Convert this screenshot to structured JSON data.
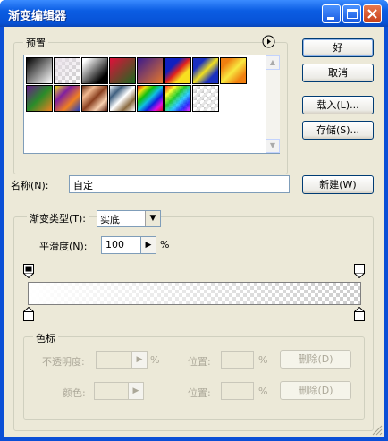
{
  "window": {
    "title": "渐变编辑器"
  },
  "presets": {
    "label": "预置",
    "menu_icon": "circle-arrow-right-icon",
    "swatches": [
      "black-white",
      "transparent-checker",
      "black-white-reverse",
      "red-green",
      "violet-orange",
      "blue-red-yellow",
      "blue-yellow-blue",
      "orange-yellow-orange",
      "violet-green-orange",
      "yellow-violet-orange-blue",
      "copper",
      "chrome",
      "spectrum",
      "transparent-rainbow",
      "transparent-stripes"
    ]
  },
  "buttons": {
    "ok": "好",
    "cancel": "取消",
    "load": "载入(L)...",
    "save": "存储(S)...",
    "new": "新建(W)"
  },
  "name": {
    "label": "名称(N):",
    "value": "自定"
  },
  "gradient": {
    "type_label": "渐变类型(T):",
    "type_value": "实底",
    "smoothness_label": "平滑度(N):",
    "smoothness_value": "100",
    "smoothness_unit": "%"
  },
  "color_stops": {
    "label": "色标",
    "opacity_label": "不透明度:",
    "opacity_unit": "%",
    "location_label": "位置:",
    "location_unit": "%",
    "color_label": "颜色:",
    "delete_label": "删除(D)"
  },
  "colors": {
    "title_bar": "#0a5ce0",
    "dialog_bg": "#ece9d8"
  }
}
